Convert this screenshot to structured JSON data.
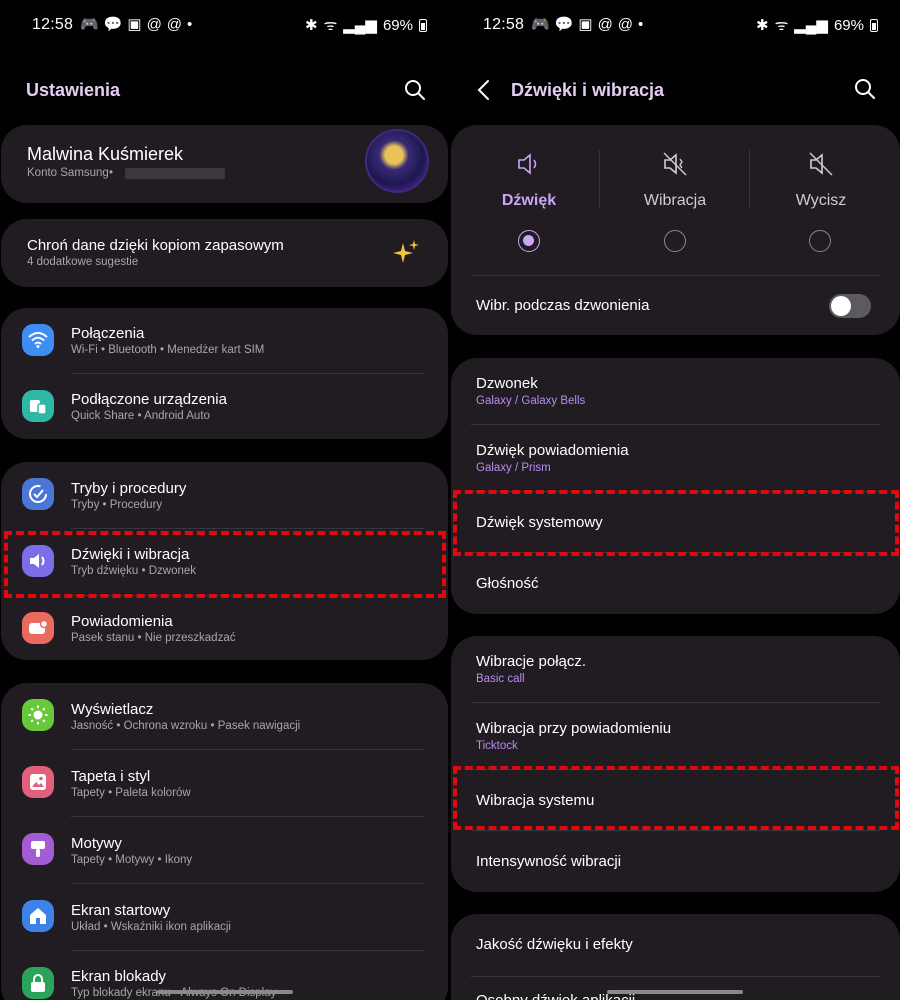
{
  "status": {
    "time": "12:58",
    "battery": "69%"
  },
  "left": {
    "title": "Ustawienia",
    "profile": {
      "name": "Malwina Kuśmierek",
      "sub": "Konto Samsung"
    },
    "backup": {
      "title": "Chroń dane dzięki kopiom zapasowym",
      "sub": "4 dodatkowe sugestie"
    },
    "items": [
      {
        "title": "Połączenia",
        "sub": "Wi-Fi  •  Bluetooth  •  Menedżer kart SIM",
        "color": "#3d8ef0",
        "icon": "wifi-icon"
      },
      {
        "title": "Podłączone urządzenia",
        "sub": "Quick Share  •  Android Auto",
        "color": "#2fb7a6",
        "icon": "devices-icon"
      },
      {
        "title": "Tryby i procedury",
        "sub": "Tryby  •  Procedury",
        "color": "#4a76d6",
        "icon": "modes-icon"
      },
      {
        "title": "Dźwięki i wibracja",
        "sub": "Tryb dźwięku  •  Dzwonek",
        "color": "#7d6de8",
        "icon": "speaker-icon"
      },
      {
        "title": "Powiadomienia",
        "sub": "Pasek stanu  •  Nie przeszkadzać",
        "color": "#ea6a5e",
        "icon": "notification-icon"
      },
      {
        "title": "Wyświetlacz",
        "sub": "Jasność  •  Ochrona wzroku  •  Pasek nawigacji",
        "color": "#67c83a",
        "icon": "brightness-icon"
      },
      {
        "title": "Tapeta i styl",
        "sub": "Tapety  •  Paleta kolorów",
        "color": "#e2607c",
        "icon": "wallpaper-icon"
      },
      {
        "title": "Motywy",
        "sub": "Tapety  •  Motywy  •  Ikony",
        "color": "#a35bd6",
        "icon": "themes-icon"
      },
      {
        "title": "Ekran startowy",
        "sub": "Układ  •  Wskaźniki ikon aplikacji",
        "color": "#3e82e8",
        "icon": "home-icon"
      },
      {
        "title": "Ekran blokady",
        "sub": "Typ blokady ekranu  •  Always On Display",
        "color": "#2ba45a",
        "icon": "lock-icon"
      }
    ]
  },
  "right": {
    "title": "Dźwięki i wibracja",
    "modes": [
      {
        "label": "Dźwięk",
        "active": true
      },
      {
        "label": "Wibracja",
        "active": false
      },
      {
        "label": "Wycisz",
        "active": false
      }
    ],
    "vibrate_ring": {
      "label": "Wibr. podczas dzwonienia",
      "on": false
    },
    "group1": [
      {
        "title": "Dzwonek",
        "sub": "Galaxy / Galaxy Bells"
      },
      {
        "title": "Dźwięk powiadomienia",
        "sub": "Galaxy / Prism"
      },
      {
        "title": "Dźwięk systemowy",
        "sub": ""
      },
      {
        "title": "Głośność",
        "sub": ""
      }
    ],
    "group2": [
      {
        "title": "Wibracje połącz.",
        "sub": "Basic call"
      },
      {
        "title": "Wibracja przy powiadomieniu",
        "sub": "Ticktock"
      },
      {
        "title": "Wibracja systemu",
        "sub": ""
      },
      {
        "title": "Intensywność wibracji",
        "sub": ""
      }
    ],
    "group3": [
      {
        "title": "Jakość dźwięku i efekty"
      },
      {
        "title": "Osobny dźwięk aplikacji"
      }
    ]
  }
}
